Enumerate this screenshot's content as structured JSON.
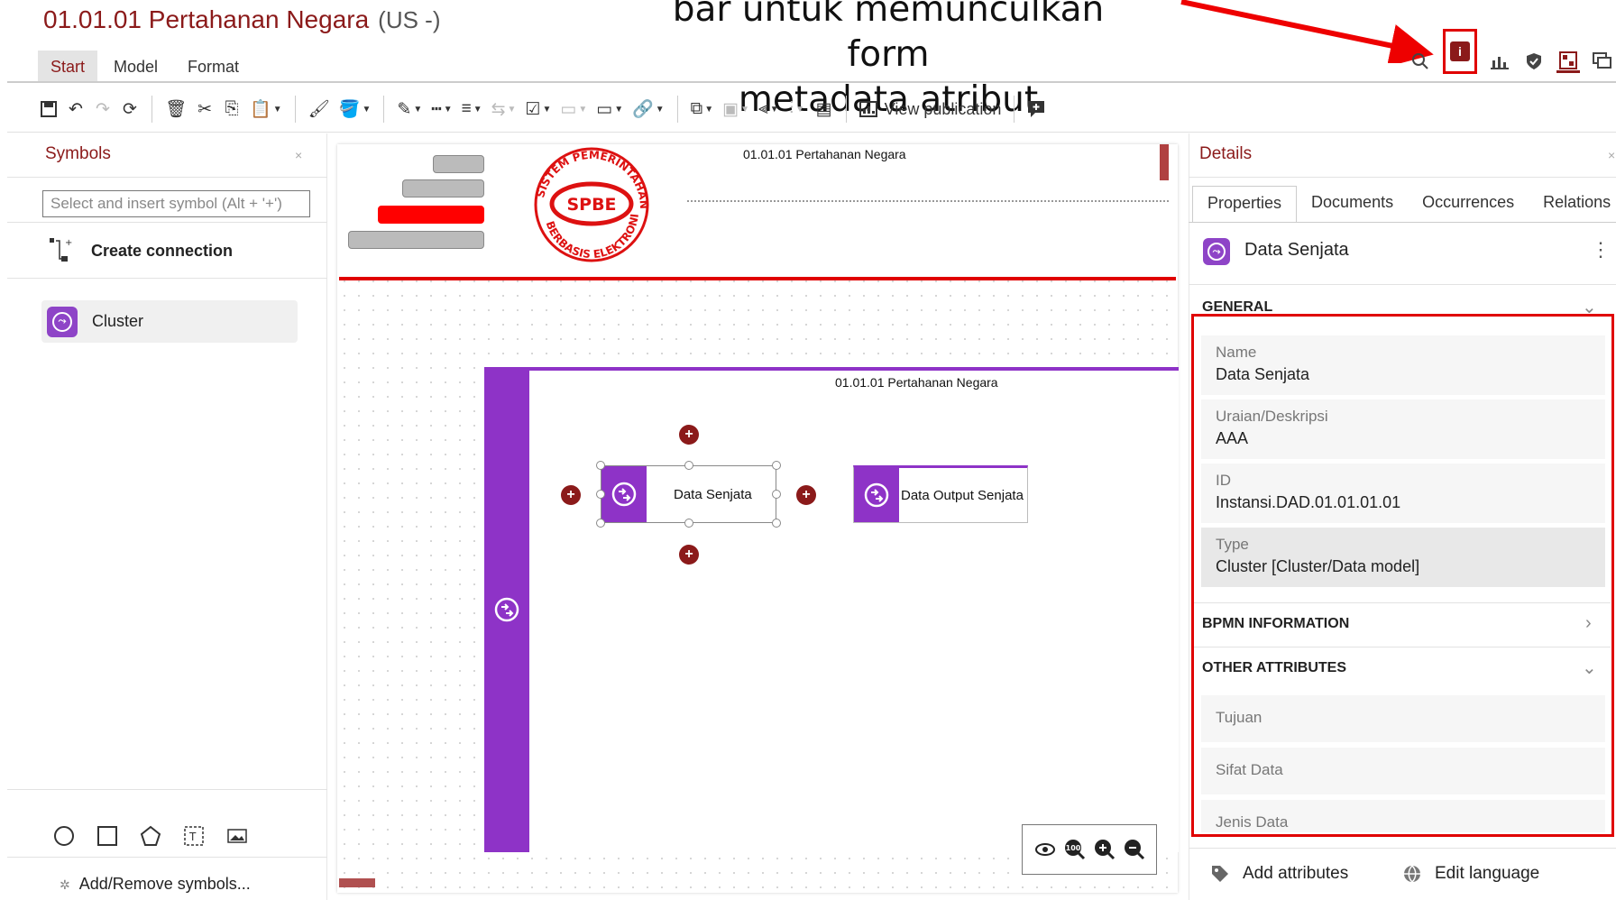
{
  "window": {
    "title": "01.01.01 Pertahanan Negara",
    "language": "(US -)"
  },
  "annotation": {
    "line1": "bar untuk memunculkan form",
    "line2": "metadata atribut"
  },
  "menu": {
    "tabs": [
      "Start",
      "Model",
      "Format"
    ],
    "active": "Start"
  },
  "right_icons": [
    "search-icon",
    "info-icon",
    "chart-icon",
    "shield-icon",
    "properties-icon",
    "comments-icon"
  ],
  "toolbar": {
    "view_publication": "View publication"
  },
  "symbols": {
    "title": "Symbols",
    "close": "×",
    "search_placeholder": "Select and insert symbol (Alt + '+')",
    "create_connection": "Create connection",
    "items": [
      {
        "label": "Cluster",
        "icon": "cluster-icon"
      }
    ],
    "add_remove": "Add/Remove symbols..."
  },
  "canvas": {
    "header_title": "01.01.01 Pertahanan Negara",
    "logo_top": "SISTEM PEMERINTAHAN",
    "logo_center": "SPBE",
    "logo_bottom": "BERBASIS ELEKTRONIK",
    "pool_title": "01.01.01 Pertahanan Negara",
    "nodes": [
      {
        "label": "Data Senjata"
      },
      {
        "label": "Data Output Senjata"
      }
    ],
    "zoom_badge": "100"
  },
  "details": {
    "title": "Details",
    "close": "×",
    "tabs": [
      "Properties",
      "Documents",
      "Occurrences",
      "Relations"
    ],
    "object_name": "Data Senjata",
    "more": "⋮",
    "general_label": "GENERAL",
    "fields": [
      {
        "label": "Name",
        "value": "Data Senjata"
      },
      {
        "label": "Uraian/Deskripsi",
        "value": "AAA"
      },
      {
        "label": "ID",
        "value": "Instansi.DAD.01.01.01.01"
      },
      {
        "label": "Type",
        "value": "Cluster [Cluster/Data model]"
      }
    ],
    "bpmn_label": "BPMN INFORMATION",
    "other_label": "OTHER ATTRIBUTES",
    "other_fields": [
      "Tujuan",
      "Sifat Data",
      "Jenis Data"
    ],
    "footer": {
      "add_attributes": "Add attributes",
      "edit_language": "Edit language"
    }
  },
  "colors": {
    "brand": "#8b1a1a",
    "accent": "#8e33c7",
    "highlight": "#e00000"
  }
}
